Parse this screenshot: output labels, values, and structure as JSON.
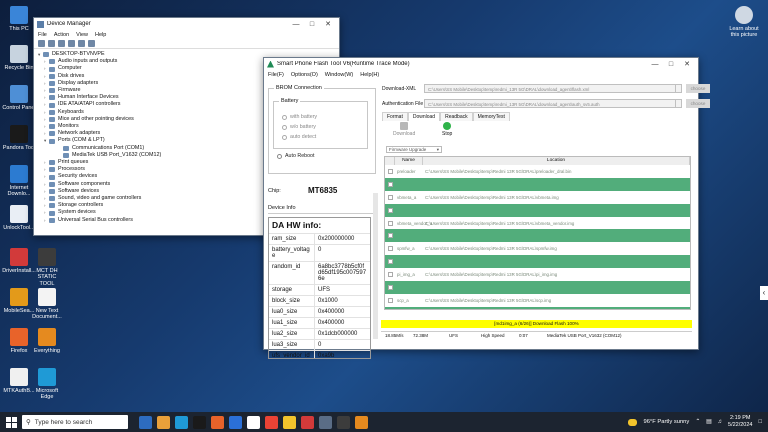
{
  "desktop": {
    "icons": [
      {
        "label": "This PC",
        "color": "#3a85d8"
      },
      {
        "label": "Recycle Bin",
        "color": "#c7d3df"
      },
      {
        "label": "Control Panel",
        "color": "#4e8fd6"
      },
      {
        "label": "Pandora Tool",
        "color": "#1a1a1a"
      },
      {
        "label": "Internet Downlo...",
        "color": "#2c7bd1"
      },
      {
        "label": "UnlockTool...",
        "color": "#e9eef5"
      },
      {
        "label": "DriverInstall...",
        "color": "#d23a3a"
      },
      {
        "label": "MCT DH STATIC TOOL",
        "color": "#3c3c3c"
      },
      {
        "label": "MobileSea...",
        "color": "#e39a1a"
      },
      {
        "label": "New Text Document...",
        "color": "#f3f3f3"
      },
      {
        "label": "Firefox",
        "color": "#e8632a"
      },
      {
        "label": "Everything",
        "color": "#e58a1f"
      },
      {
        "label": "MTKAuthB...",
        "color": "#f0f0f0"
      },
      {
        "label": "Microsoft Edge",
        "color": "#1f9ad6"
      }
    ],
    "learn_label": "Learn about this picture"
  },
  "device_manager": {
    "title": "Device Manager",
    "menu": [
      "File",
      "Action",
      "View",
      "Help"
    ],
    "root": "DESKTOP-BTVNVPE",
    "categories": [
      "Audio inputs and outputs",
      "Computer",
      "Disk drives",
      "Display adapters",
      "Firmware",
      "Human Interface Devices",
      "IDE ATA/ATAPI controllers",
      "Keyboards",
      "Mice and other pointing devices",
      "Monitors",
      "Network adapters",
      "Ports (COM & LPT)",
      "Communications Port (COM1)",
      "MediaTek USB Port_V1632 (COM12)",
      "Print queues",
      "Processors",
      "Security devices",
      "Software components",
      "Software devices",
      "Sound, video and game controllers",
      "Storage controllers",
      "System devices",
      "Universal Serial Bus controllers"
    ]
  },
  "flash_tool": {
    "title": "Smart Phone Flash Tool V6(Runtime Trace Mode)",
    "menu": [
      "File(F)",
      "Options(O)",
      "Window(W)",
      "Help(H)"
    ],
    "brom_label": "BROM Connection",
    "battery_label": "Battery",
    "battery_options": [
      "with battery",
      "w/o battery",
      "auto detect"
    ],
    "auto_reboot": "Auto Reboot",
    "chip_label": "Chip:",
    "chip_value": "MT6835",
    "device_info_label": "Device Info",
    "da_title": "DA HW info:",
    "da_info": [
      {
        "k": "ram_size",
        "v": "0x200000000"
      },
      {
        "k": "battery_voltage",
        "v": "0"
      },
      {
        "k": "random_id",
        "v": "6a8bc3778b5cf0fd65df195c0075976e"
      },
      {
        "k": "storage",
        "v": "UFS"
      },
      {
        "k": "block_size",
        "v": "0x1000"
      },
      {
        "k": "lua0_size",
        "v": "0x400000"
      },
      {
        "k": "lua1_size",
        "v": "0x400000"
      },
      {
        "k": "lua2_size",
        "v": "0x1dcb000000"
      },
      {
        "k": "lua3_size",
        "v": "0"
      },
      {
        "k": "ufs_vendor_id",
        "v": "0xa9b"
      }
    ],
    "download_xml_label": "Download-XML",
    "download_xml_value": "C:\\Users\\SS Mobile\\Desktop\\temp\\redmi_13R 5G\\DRAL\\download_agent\\flash.xml",
    "auth_label": "Authentication File",
    "auth_value": "C:\\Users\\SS Mobile\\Desktop\\temp\\redmi_13R 5G\\DRAL\\download_agent\\auth_sv5.auth",
    "choose_label": "choose",
    "tabs": [
      "Format",
      "Download",
      "Readback",
      "MemoryTest"
    ],
    "active_tab": "Download",
    "download_btn": "Download",
    "stop_btn": "Stop",
    "firmware_select": "Firmware Upgrade",
    "col_name": "Name",
    "col_location": "Location",
    "rows": [
      {
        "name": "preloader",
        "loc": "C:\\Users\\SS Mobile\\Desktop\\temp\\Redmi 13R 5G\\DRAL\\preloader_dral.bin"
      },
      {
        "name": "",
        "loc": ""
      },
      {
        "name": "vbmeta_a",
        "loc": "C:\\Users\\SS Mobile\\Desktop\\temp\\Redmi 13R 5G\\DRAL\\vbmeta.img"
      },
      {
        "name": "",
        "loc": ""
      },
      {
        "name": "vbmeta_vendor_a",
        "loc": "C:\\Users\\SS Mobile\\Desktop\\temp\\Redmi 13R 5G\\DRAL\\vbmeta_vendor.img"
      },
      {
        "name": "",
        "loc": ""
      },
      {
        "name": "spmfw_a",
        "loc": "C:\\Users\\SS Mobile\\Desktop\\temp\\Redmi 13R 5G\\DRAL\\spmfw.img"
      },
      {
        "name": "",
        "loc": ""
      },
      {
        "name": "pi_img_a",
        "loc": "C:\\Users\\SS Mobile\\Desktop\\temp\\Redmi 13R 5G\\DRAL\\pi_img.img"
      },
      {
        "name": "",
        "loc": ""
      },
      {
        "name": "scp_a",
        "loc": "C:\\Users\\SS Mobile\\Desktop\\temp\\Redmi 13R 5G\\DRAL\\scp.img"
      },
      {
        "name": "",
        "loc": ""
      }
    ],
    "status_text": "[md1img_a (6/26)] Download Flash 100%",
    "info": [
      "18.85M/s",
      "72.38M",
      "UFS",
      "High Speed",
      "0:07",
      "MediaTek USB Port_V1632 (COM12)"
    ]
  },
  "taskbar": {
    "search_placeholder": "Type here to search",
    "apps": [
      "#2d6cc0",
      "#e9a03a",
      "#1f9ad6",
      "#1a1a1a",
      "#e8632a",
      "#2b70d8",
      "#ffffff",
      "#ea4335",
      "#f2c42c",
      "#d23a3a",
      "#5a6d86",
      "#3c3c3c",
      "#e58a1f"
    ],
    "weather": "96°F  Partly sunny",
    "time": "2:19 PM",
    "date": "5/22/2024"
  }
}
